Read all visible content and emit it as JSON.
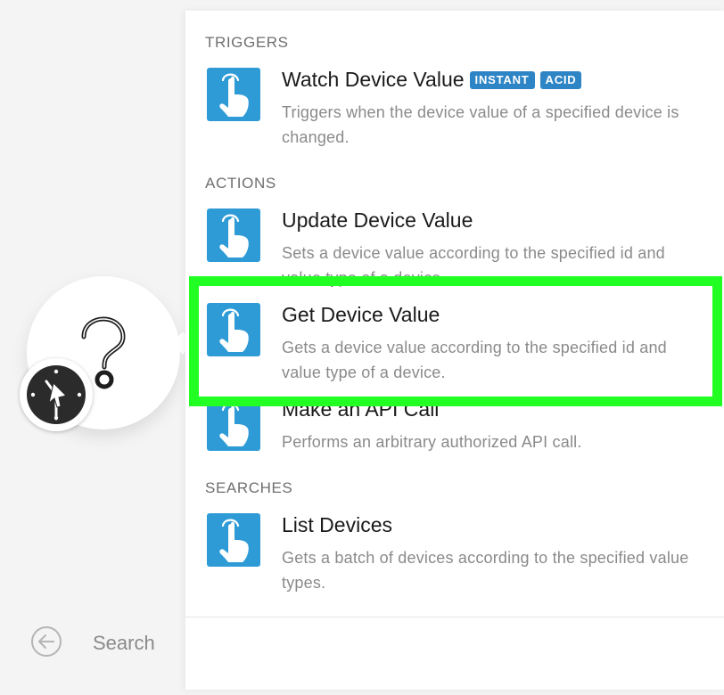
{
  "scenario_node": {
    "module_icon": "question-mark-icon",
    "schedule_icon": "clock-icon"
  },
  "panel": {
    "sections": [
      {
        "label": "TRIGGERS",
        "items": [
          {
            "title": "Watch Device Value",
            "badges": [
              "INSTANT",
              "ACID"
            ],
            "description": "Triggers when the device value of a specified device is changed."
          }
        ]
      },
      {
        "label": "ACTIONS",
        "items": [
          {
            "title": "Update Device Value",
            "description": "Sets a device value according to the specified id and value type of a device."
          },
          {
            "title": "Get Device Value",
            "description": "Gets a device value according to the specified id and value type of a device."
          },
          {
            "title": "Make an API Call",
            "description": "Performs an arbitrary authorized API call."
          }
        ]
      },
      {
        "label": "SEARCHES",
        "items": [
          {
            "title": "List Devices",
            "description": "Gets a batch of devices according to the specified value types."
          }
        ]
      }
    ],
    "item_icon": "hand-pointer-icon",
    "footer": {
      "back_icon": "back-arrow-icon",
      "search_placeholder": "Search"
    }
  },
  "colors": {
    "app_icon_bg": "#2e9bd6",
    "badge_bg": "#2e85c6",
    "highlight": "#22ff22"
  }
}
